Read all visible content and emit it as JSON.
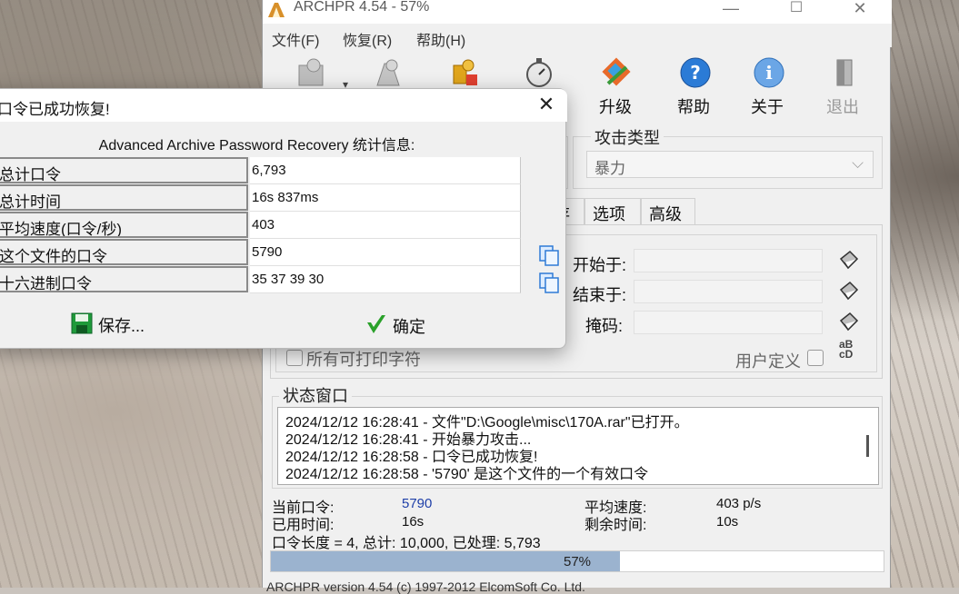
{
  "window": {
    "title": "ARCHPR 4.54 - 57%",
    "minimize": "—",
    "maximize": "☐",
    "close": "✕"
  },
  "menu": [
    "文件(F)",
    "恢复(R)",
    "帮助(H)"
  ],
  "toolbar": {
    "upgrade_label": "升级",
    "help_label": "帮助",
    "about_label": "关于",
    "exit_label": "退出",
    "dropdown_arrow": "▾"
  },
  "attack": {
    "group_title": "攻击类型",
    "selected": "暴力",
    "dropdown_arrow": "⌵"
  },
  "tabs": [
    "存",
    "选项",
    "高级"
  ],
  "range": {
    "start_label": "开始于:",
    "end_label": "结束于:",
    "mask_label": "掩码:",
    "all_printable": "所有可打印字符",
    "user_defined": "用户定义",
    "charset_icon_text": "aB\ncD"
  },
  "status": {
    "group_title": "状态窗口",
    "lines": [
      "2024/12/12 16:28:41 - 文件\"D:\\Google\\misc\\170A.rar\"已打开。",
      "2024/12/12 16:28:41 - 开始暴力攻击...",
      "2024/12/12 16:28:58 - 口令已成功恢复!",
      "2024/12/12 16:28:58 - '5790' 是这个文件的一个有效口令"
    ]
  },
  "info": {
    "current_label": "当前口令:",
    "current_value": "5790",
    "elapsed_label": "已用时间:",
    "elapsed_value": "16s",
    "avg_label": "平均速度:",
    "avg_value": "403 p/s",
    "remaining_label": "剩余时间:",
    "remaining_value": "10s",
    "summary": "口令长度 = 4, 总计: 10,000, 已处理: 5,793"
  },
  "progress": {
    "percent": 57,
    "text": "57%"
  },
  "statusbar": "ARCHPR version 4.54 (c) 1997-2012 ElcomSoft Co. Ltd.",
  "dialog": {
    "title": "口令已成功恢复!",
    "close": "✕",
    "header": "Advanced Archive Password Recovery 统计信息:",
    "rows": [
      {
        "label": "总计口令",
        "value": "6,793"
      },
      {
        "label": "总计时间",
        "value": "16s 837ms"
      },
      {
        "label": "平均速度(口令/秒)",
        "value": "403"
      },
      {
        "label": "这个文件的口令",
        "value": "5790"
      },
      {
        "label": "十六进制口令",
        "value": "35 37 39 30"
      }
    ],
    "save_label": "保存...",
    "ok_label": "确定"
  },
  "colors": {
    "progress_fill": "#9bb3cf",
    "help_icon": "#2b7bd6",
    "save_icon": "#1f9a3a",
    "ok_check": "#2aa12a"
  }
}
